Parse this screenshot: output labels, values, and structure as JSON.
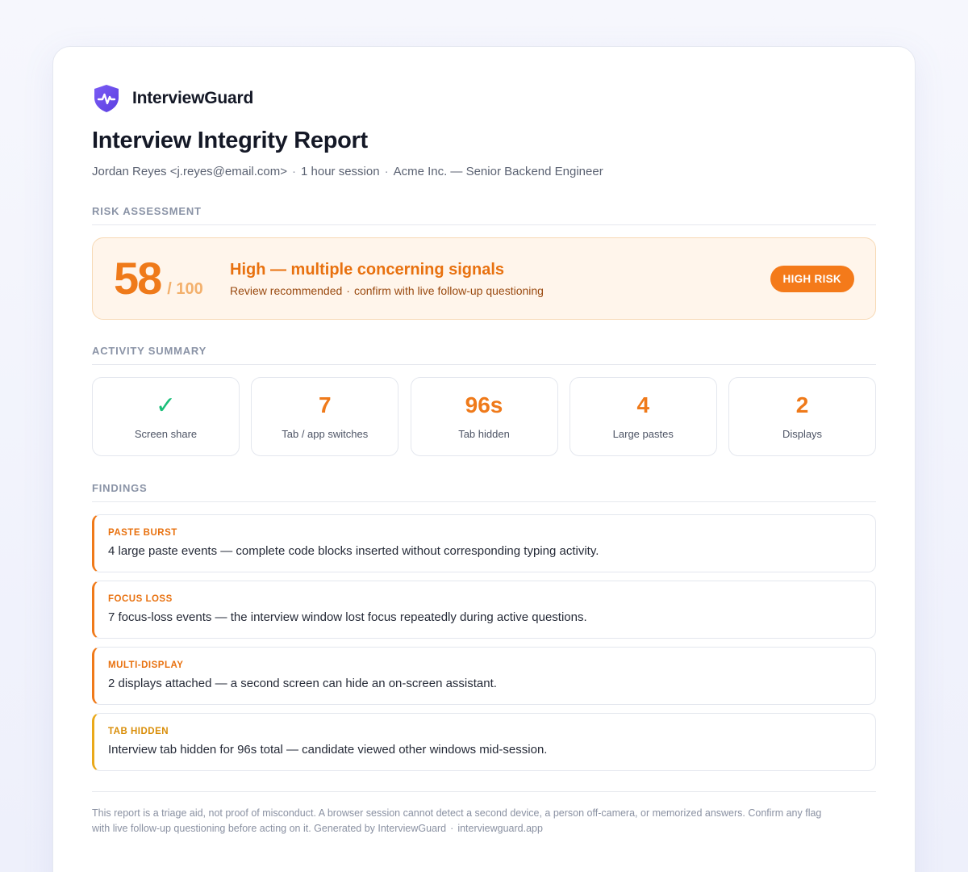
{
  "brand": {
    "name": "InterviewGuard",
    "icon": "shield-pulse-icon",
    "color": "#6a4cf0"
  },
  "report": {
    "title": "Interview Integrity Report",
    "candidate": "Jordan Reyes <j.reyes@email.com>",
    "session": "1 hour session",
    "company_role": "Acme Inc. — Senior Backend Engineer",
    "separator": "·"
  },
  "risk_assessment": {
    "section_label": "RISK ASSESSMENT",
    "score": "58",
    "score_max": "/ 100",
    "score_fraction": 0.58,
    "headline": "High — multiple concerning signals",
    "note_1": "Review recommended",
    "note_2": "confirm with live follow-up questioning",
    "badge": "HIGH RISK",
    "accent_color": "#f47a1a"
  },
  "activity_summary": {
    "section_label": "ACTIVITY SUMMARY",
    "stats": [
      {
        "value": "✓",
        "label": "Screen share",
        "icon": "checkmark-icon",
        "color": "#1bbf7a"
      },
      {
        "value": "7",
        "label": "Tab / app switches"
      },
      {
        "value": "96s",
        "label": "Tab hidden"
      },
      {
        "value": "4",
        "label": "Large pastes"
      },
      {
        "value": "2",
        "label": "Displays"
      }
    ]
  },
  "findings": {
    "section_label": "FINDINGS",
    "items": [
      {
        "tag": "PASTE BURST",
        "text": "4 large paste events — complete code blocks inserted without corresponding typing activity.",
        "severity_color": "#f07a1a"
      },
      {
        "tag": "FOCUS LOSS",
        "text": "7 focus-loss events — the interview window lost focus repeatedly during active questions.",
        "severity_color": "#f07a1a"
      },
      {
        "tag": "MULTI-DISPLAY",
        "text": "2 displays attached — a second screen can hide an on-screen assistant.",
        "severity_color": "#f07a1a"
      },
      {
        "tag": "TAB HIDDEN",
        "text": "Interview tab hidden for 96s total — candidate viewed other windows mid-session.",
        "severity_color": "#eaa91a"
      }
    ]
  },
  "footer": {
    "line_1": "This report is a triage aid, not proof of misconduct. A browser session cannot detect a second device, a person off-camera, or memorized answers. Confirm any flag",
    "line_2": "with live follow-up questioning before acting on it. Generated by InterviewGuard",
    "site": "interviewguard.app"
  }
}
